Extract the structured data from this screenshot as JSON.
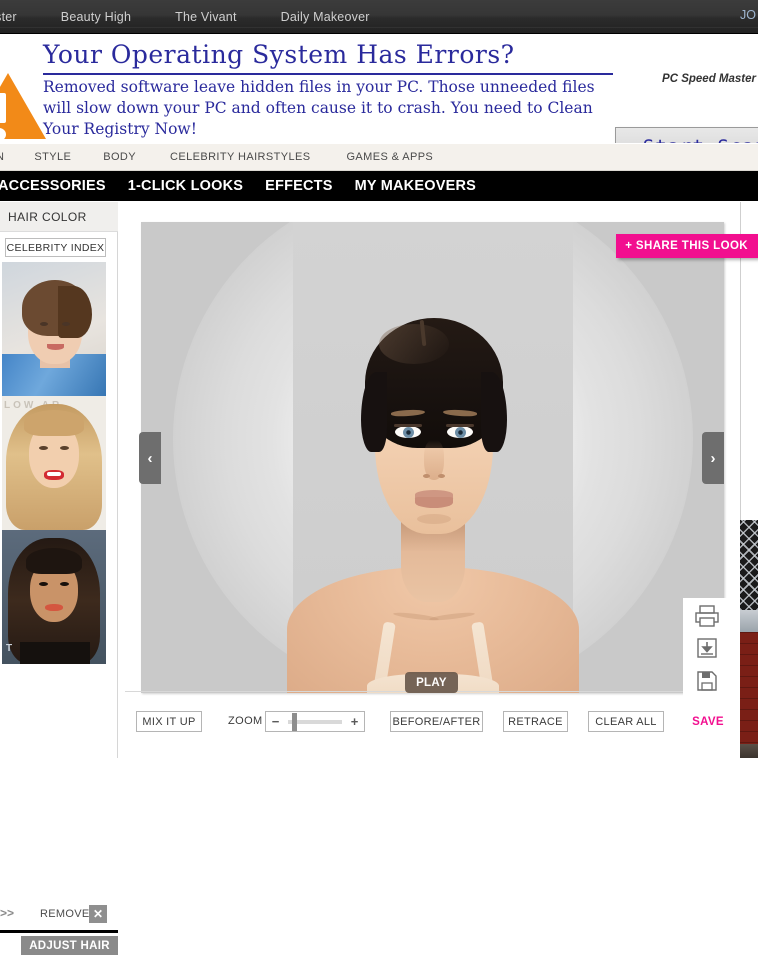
{
  "partner_bar": {
    "links": [
      "aster",
      "Beauty High",
      "The Vivant",
      "Daily Makeover"
    ],
    "right_label": "JO"
  },
  "ad": {
    "headline": "Your Operating System Has Errors?",
    "body": "Removed software leave hidden files in your PC. Those unneeded files will slow down your PC and often cause it to crash. You need to Clean Your Registry Now!",
    "brand": "PC Speed Master",
    "cta": "Start Scan",
    "warning_icon": "warning-triangle-icon",
    "headline_color": "#2a2a9c",
    "warning_color": "#f28a18"
  },
  "nav_light": {
    "items": [
      "N",
      "STYLE",
      "BODY",
      "CELEBRITY HAIRSTYLES",
      "GAMES & APPS"
    ]
  },
  "nav_dark": {
    "items": [
      "ACCESSORIES",
      "1-CLICK LOOKS",
      "EFFECTS",
      "MY MAKEOVERS"
    ]
  },
  "sidebar": {
    "title": "HAIR COLOR",
    "celebrity_index_label": "CELEBRITY INDEX",
    "thumbnails": [
      {
        "name": "celebrity-thumb-1",
        "alt": "short brown pixie hairstyle, blue dress"
      },
      {
        "name": "celebrity-thumb-2",
        "alt": "long blonde hairstyle, red lipstick",
        "overlay_text": "LOW            AR"
      },
      {
        "name": "celebrity-thumb-3",
        "alt": "dark wavy hairstyle, coral lipstick",
        "overlay_text": "T"
      }
    ],
    "chevron": ">>",
    "remove_label": "REMOVE",
    "remove_x": "✕",
    "adjust_label": "ADJUST HAIR"
  },
  "stage": {
    "share_label": "+ SHARE THIS LOOK",
    "share_color": "#f20f8f",
    "prev_arrow": "‹",
    "next_arrow": "›",
    "play_label": "PLAY",
    "portrait_alt": "model front-facing portrait with dark slicked-back hair",
    "side_icons": [
      "print-icon",
      "download-icon",
      "floppy-save-icon"
    ]
  },
  "toolbar": {
    "mix_it_up": "MIX IT UP",
    "zoom_label": "ZOOM",
    "zoom_minus": "−",
    "zoom_plus": "+",
    "zoom_value": 5,
    "before_after": "BEFORE/AFTER",
    "retrace": "RETRACE",
    "clear_all": "CLEAR ALL",
    "save": "SAVE",
    "save_color": "#f20f8f"
  },
  "right_ad": {
    "alt": "partially visible side advertisement with chain-link fence over brick wall"
  }
}
